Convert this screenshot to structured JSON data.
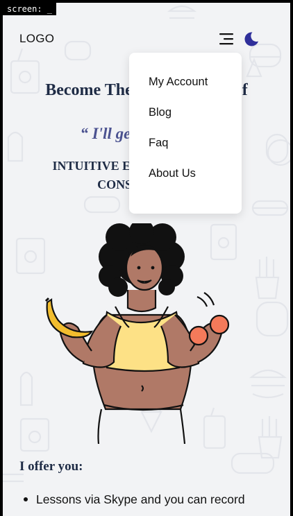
{
  "screen_tag": "screen: _",
  "header": {
    "logo": "LOGO",
    "menu_icon": "hamburger-menu-icon",
    "theme_icon": "moon-icon"
  },
  "hero": {
    "title": "Become The Best Version Of You",
    "quote": "“ I'll get you there ”",
    "subtitle": "INTUITIVE EATING & WEIGHT CONSULTATION"
  },
  "dropdown": {
    "items": [
      "My Account",
      "Blog",
      "Faq",
      "About Us"
    ]
  },
  "offer": {
    "title": "I offer you:",
    "items": [
      "Lessons via Skype and you can record"
    ]
  },
  "colors": {
    "background": "#f2f3f5",
    "heading": "#1e2b45",
    "quote": "#4b5290",
    "moon": "#2f2f9a"
  }
}
